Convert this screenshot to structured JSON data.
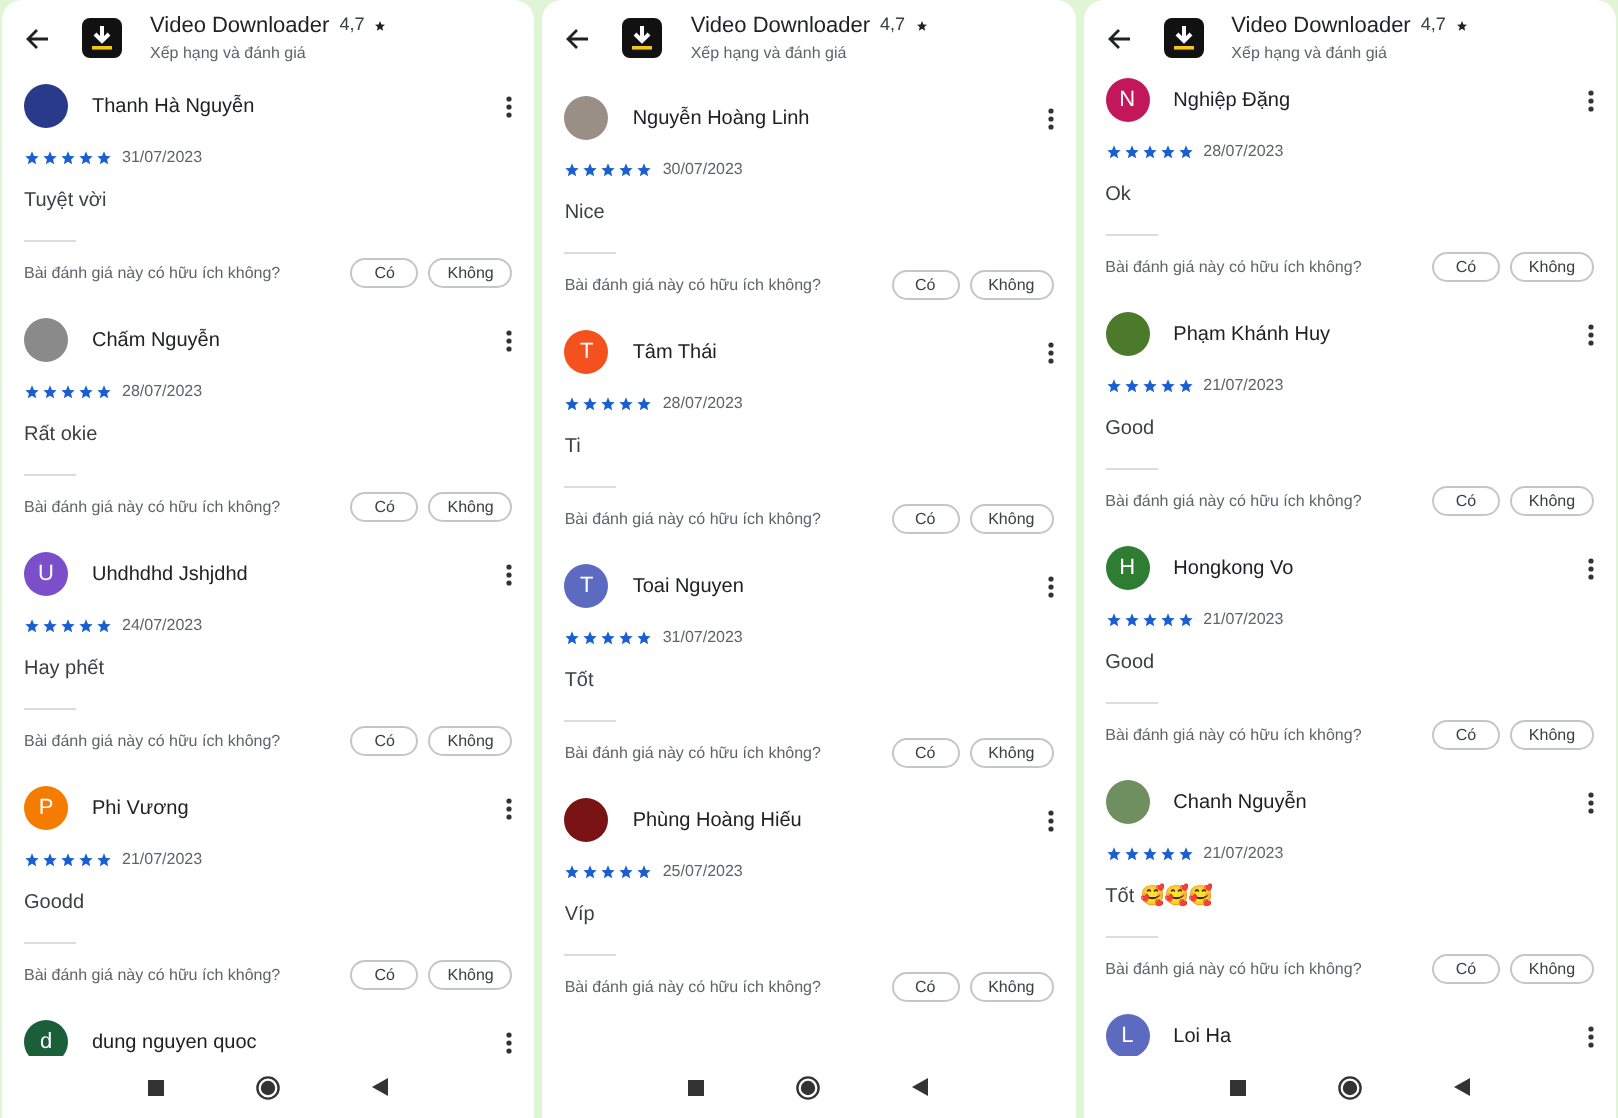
{
  "screens": [
    {
      "app": {
        "name": "Video Downloader",
        "rating": "4,7",
        "subtitle": "Xếp hạng và đánh giá"
      },
      "reviews": [
        {
          "name": "Thanh Hà Nguyễn",
          "avatar": {
            "kind": "photo",
            "color": "#2a3a8a"
          },
          "stars": 5,
          "date": "31/07/2023",
          "text": "Tuyệt vời",
          "question": "Bài đánh giá này có hữu ích không?",
          "yes": "Có",
          "no": "Không"
        },
        {
          "name": "Chấm Nguyễn",
          "avatar": {
            "kind": "photo",
            "color": "#8a8a8a"
          },
          "stars": 5,
          "date": "28/07/2023",
          "text": "Rất okie",
          "question": "Bài đánh giá này có hữu ích không?",
          "yes": "Có",
          "no": "Không"
        },
        {
          "name": "Uhdhdhd Jshjdhd",
          "avatar": {
            "kind": "letter",
            "letter": "U",
            "color": "#7b4fc9"
          },
          "stars": 5,
          "date": "24/07/2023",
          "text": "Hay phết",
          "question": "Bài đánh giá này có hữu ích không?",
          "yes": "Có",
          "no": "Không"
        },
        {
          "name": "Phi Vương",
          "avatar": {
            "kind": "letter",
            "letter": "P",
            "color": "#f57c00"
          },
          "stars": 5,
          "date": "21/07/2023",
          "text": "Goodd",
          "question": "Bài đánh giá này có hữu ích không?",
          "yes": "Có",
          "no": "Không"
        },
        {
          "name": "dung nguyen quoc",
          "avatar": {
            "kind": "letter",
            "letter": "d",
            "color": "#1b5e3a"
          }
        }
      ]
    },
    {
      "app": {
        "name": "Video Downloader",
        "rating": "4,7",
        "subtitle": "Xếp hạng và đánh giá"
      },
      "reviews": [
        {
          "name": "Nguyễn Hoàng Linh",
          "avatar": {
            "kind": "photo",
            "color": "#9a8f86"
          },
          "stars": 5,
          "date": "30/07/2023",
          "text": "Nice",
          "question": "Bài đánh giá này có hữu ích không?",
          "yes": "Có",
          "no": "Không"
        },
        {
          "name": "Tâm Thái",
          "avatar": {
            "kind": "letter",
            "letter": "T",
            "color": "#f4511e"
          },
          "stars": 5,
          "date": "28/07/2023",
          "text": "Ti",
          "question": "Bài đánh giá này có hữu ích không?",
          "yes": "Có",
          "no": "Không"
        },
        {
          "name": "Toai Nguyen",
          "avatar": {
            "kind": "letter",
            "letter": "T",
            "color": "#5c6bc0"
          },
          "stars": 5,
          "date": "31/07/2023",
          "text": "Tốt",
          "question": "Bài đánh giá này có hữu ích không?",
          "yes": "Có",
          "no": "Không"
        },
        {
          "name": "Phùng Hoàng Hiếu",
          "avatar": {
            "kind": "photo",
            "color": "#7a1414"
          },
          "stars": 5,
          "date": "25/07/2023",
          "text": "Víp",
          "question": "Bài đánh giá này có hữu ích không?",
          "yes": "Có",
          "no": "Không"
        }
      ]
    },
    {
      "app": {
        "name": "Video Downloader",
        "rating": "4,7",
        "subtitle": "Xếp hạng và đánh giá"
      },
      "reviews": [
        {
          "name": "Nghiệp Đặng",
          "avatar": {
            "kind": "letter",
            "letter": "N",
            "color": "#c2185b"
          },
          "stars": 5,
          "date": "28/07/2023",
          "text": "Ok",
          "question": "Bài đánh giá này có hữu ích không?",
          "yes": "Có",
          "no": "Không"
        },
        {
          "name": "Phạm Khánh Huy",
          "avatar": {
            "kind": "photo",
            "color": "#4a7a2a"
          },
          "stars": 5,
          "date": "21/07/2023",
          "text": "Good",
          "question": "Bài đánh giá này có hữu ích không?",
          "yes": "Có",
          "no": "Không"
        },
        {
          "name": "Hongkong Vo",
          "avatar": {
            "kind": "letter",
            "letter": "H",
            "color": "#2e7d32"
          },
          "stars": 5,
          "date": "21/07/2023",
          "text": "Good",
          "question": "Bài đánh giá này có hữu ích không?",
          "yes": "Có",
          "no": "Không"
        },
        {
          "name": "Chanh Nguyễn",
          "avatar": {
            "kind": "photo",
            "color": "#6f8f60"
          },
          "stars": 5,
          "date": "21/07/2023",
          "text": "Tốt 🥰🥰🥰",
          "question": "Bài đánh giá này có hữu ích không?",
          "yes": "Có",
          "no": "Không"
        },
        {
          "name": "Loi Ha",
          "avatar": {
            "kind": "letter",
            "letter": "L",
            "color": "#5c6bc0"
          }
        }
      ]
    }
  ]
}
